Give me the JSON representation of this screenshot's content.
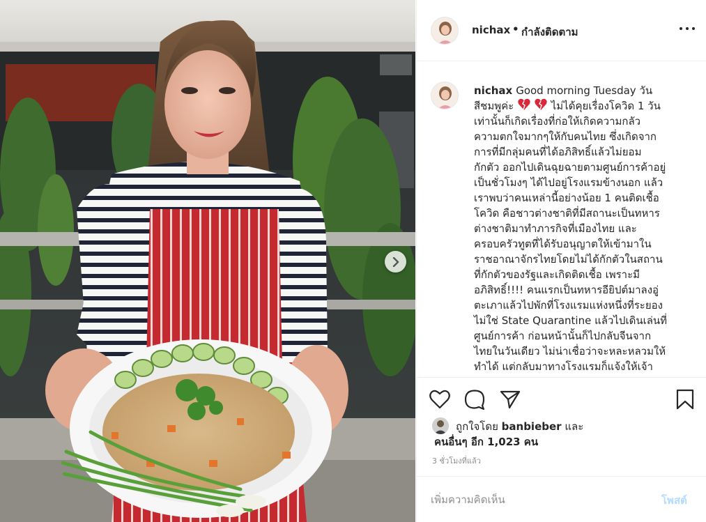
{
  "post": {
    "username": "nichax",
    "bullet": "•",
    "follow_status": "กำลังติดตาม",
    "icons": {
      "more": "more-options-icon",
      "next": "chevron-right-icon",
      "like": "heart-outline-icon",
      "comment": "comment-bubble-icon",
      "share": "paper-plane-icon",
      "save": "bookmark-icon",
      "caption_emoji": "broken-heart-emoji"
    }
  },
  "caption": {
    "username": "nichax",
    "lines": [
      "Good morning Tuesday วัน",
      "สีชมพูค่ะ",
      " ไม่ได้คุยเรื่องโควิด 1 วัน",
      "เท่านั้นก็เกิดเรื่องที่ก่อให้เกิดความกลัว",
      "ความตกใจมากๆให้กับคนไทย ซึ่งเกิดจาก",
      "การที่มีกลุ่มคนที่ได้อภิสิทธิ์แล้วไม่ยอม",
      "กักตัว ออกไปเดินฉุยฉายตามศูนย์การค้าอยู่",
      "เป็นชั่วโมงๆ ได้ไปอยู่โรงแรมข้างนอก แล้ว",
      "เราพบว่าคนเหล่านี้อย่างน้อย 1 คนติดเชื้อ",
      "โควิด คือชาวต่างชาติที่มีสถานะเป็นทหาร",
      "ต่างชาติมาทำภารกิจที่เมืองไทย และ",
      "ครอบครัวทูตที่ได้รับอนุญาตให้เข้ามาใน",
      "ราชอาณาจักรไทยโดยไม่ได้กักตัวในสถาน",
      "ที่กักตัวของรัฐและเกิดติดเชื้อ เพราะมี",
      "อภิสิทธิ์!!!! คนแรกเป็นทหารอียิปต์มาลงอู่",
      "ตะเภาแล้วไปพักที่โรงแรมแห่งหนึ่งที่ระยอง",
      "ไม่ใช่ State Quarantine แล้วไปเดินเล่นที่",
      "ศูนย์การค้า ก่อนหน้านั้นก็ไปกลับจีนจาก",
      "ไทยในวันเดียว ไม่น่าเชื่อว่าจะหละหลวมให้",
      "ทำได้ แต่กลับมาทางโรงแรมก็แจ้งให้เจ้า"
    ]
  },
  "likes": {
    "prefix": "ถูกใจโดย",
    "liker": "banbieber",
    "conj": "และ",
    "others": "คนอื่นๆ อีก 1,023 คน"
  },
  "timestamp": "3 ชั่วโมงที่แล้ว",
  "comment": {
    "placeholder": "เพิ่มความคิดเห็น",
    "post_label": "โพสต์",
    "post_color": "#b3dbff"
  }
}
